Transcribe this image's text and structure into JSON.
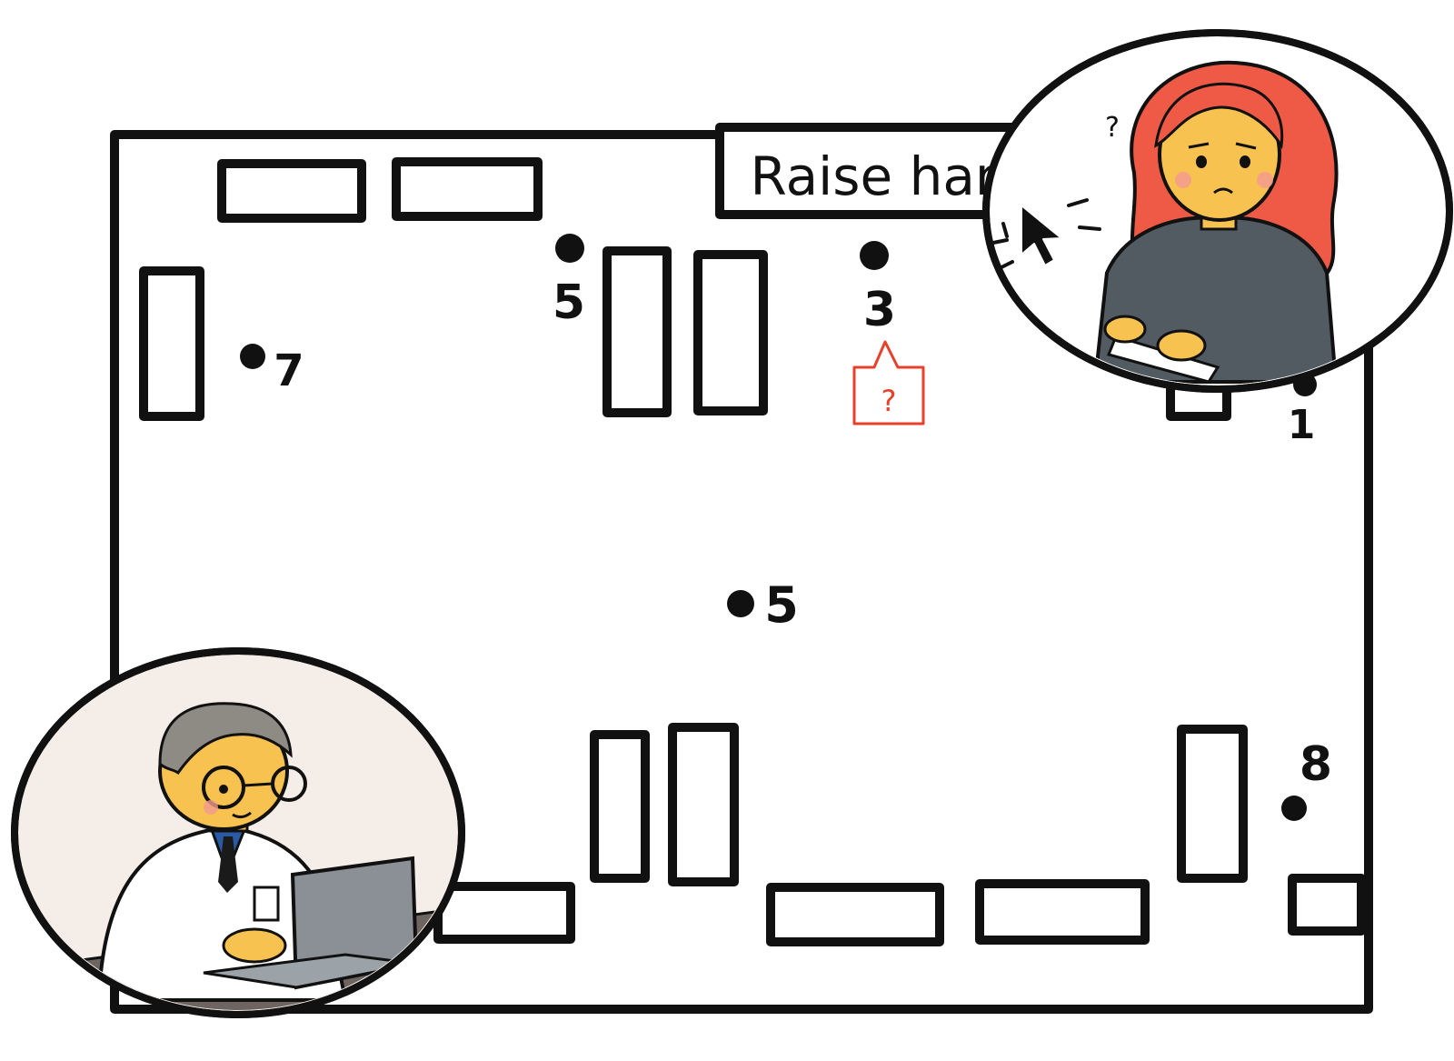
{
  "raise_hand_button": {
    "label": "Raise hand"
  },
  "markers": [
    {
      "id": "5-top",
      "label": "5"
    },
    {
      "id": "3",
      "label": "3"
    },
    {
      "id": "7",
      "label": "7"
    },
    {
      "id": "1",
      "label": "1"
    },
    {
      "id": "5-center",
      "label": "5"
    },
    {
      "id": "8",
      "label": "8"
    }
  ],
  "question_bubble": {
    "text": "?"
  },
  "student": {
    "thought": "?"
  },
  "colors": {
    "ink": "#111111",
    "accent": "#e8402a",
    "student_hair": "#ee5a45",
    "skin": "#f7c24f"
  }
}
